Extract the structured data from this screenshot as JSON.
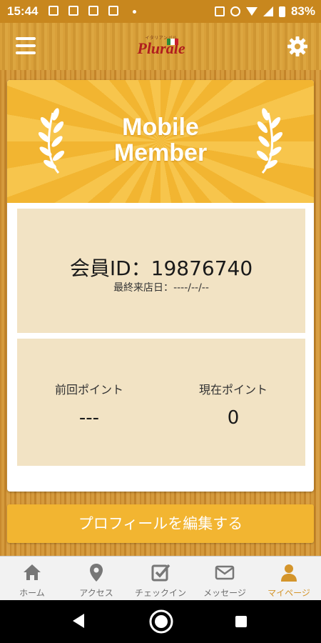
{
  "status_bar": {
    "time": "15:44",
    "battery": "83%"
  },
  "header": {
    "logo_text": "Plurale",
    "logo_subtitle": "イタリアンバル"
  },
  "banner": {
    "title_line1": "Mobile",
    "title_line2": "Member"
  },
  "member": {
    "id_label": "会員ID：",
    "id_value": "19876740",
    "last_visit_label": "最終来店日：",
    "last_visit_value": "----/--/--"
  },
  "points": {
    "previous_label": "前回ポイント",
    "previous_value": "---",
    "current_label": "現在ポイント",
    "current_value": "0"
  },
  "edit_button": {
    "label": "プロフィールを編集する"
  },
  "tabs": [
    {
      "label": "ホーム",
      "icon": "home-icon"
    },
    {
      "label": "アクセス",
      "icon": "map-pin-icon"
    },
    {
      "label": "チェックイン",
      "icon": "checkbox-icon"
    },
    {
      "label": "メッセージ",
      "icon": "envelope-icon"
    },
    {
      "label": "マイページ",
      "icon": "person-icon",
      "active": true
    }
  ],
  "colors": {
    "accent": "#f2b531",
    "active_tab": "#d4952b",
    "panel": "#f2e3c4",
    "header": "#d9a03a"
  }
}
